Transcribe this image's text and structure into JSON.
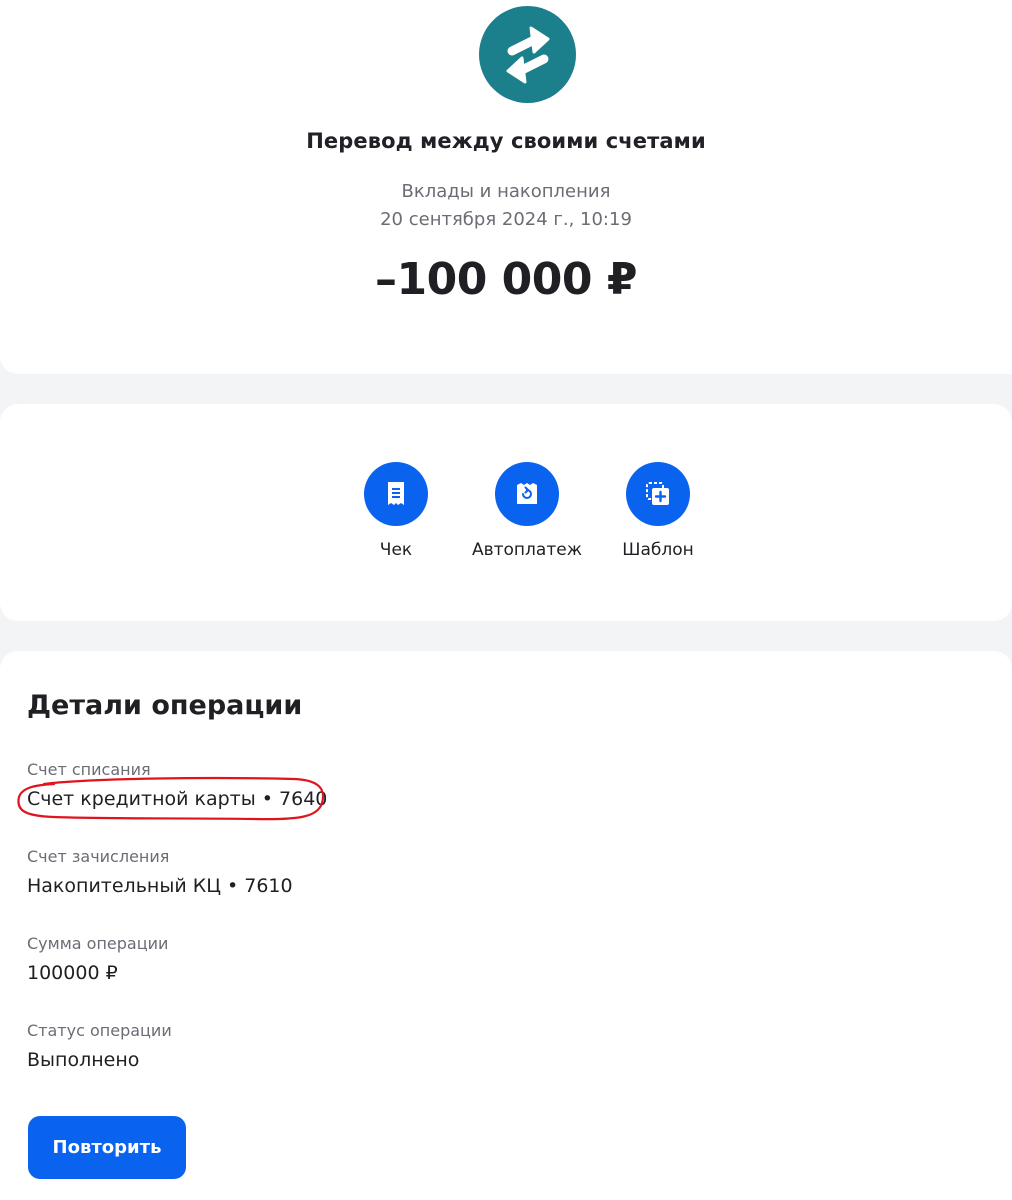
{
  "operation": {
    "title": "Перевод между своими счетами",
    "category": "Вклады и накопления",
    "datetime": "20 сентября 2024 г., 10:19",
    "amount": "–100 000 ₽",
    "icon": "transfer-arrows-icon"
  },
  "actions": [
    {
      "label": "Чек",
      "icon": "receipt-icon"
    },
    {
      "label": "Автоплатеж",
      "icon": "autopay-icon"
    },
    {
      "label": "Шаблон",
      "icon": "template-add-icon"
    }
  ],
  "details": {
    "title": "Детали операции",
    "fields": [
      {
        "label": "Счет списания",
        "value": "Счет кредитной карты • 7640"
      },
      {
        "label": "Счет зачисления",
        "value": "Накопительный КЦ • 7610"
      },
      {
        "label": "Сумма операции",
        "value": "100000 ₽"
      },
      {
        "label": "Статус операции",
        "value": "Выполнено"
      }
    ],
    "repeat_label": "Повторить"
  },
  "colors": {
    "accent": "#0a63ee",
    "operation_icon_bg": "#1b7f8c",
    "annotation": "#e0141e"
  }
}
